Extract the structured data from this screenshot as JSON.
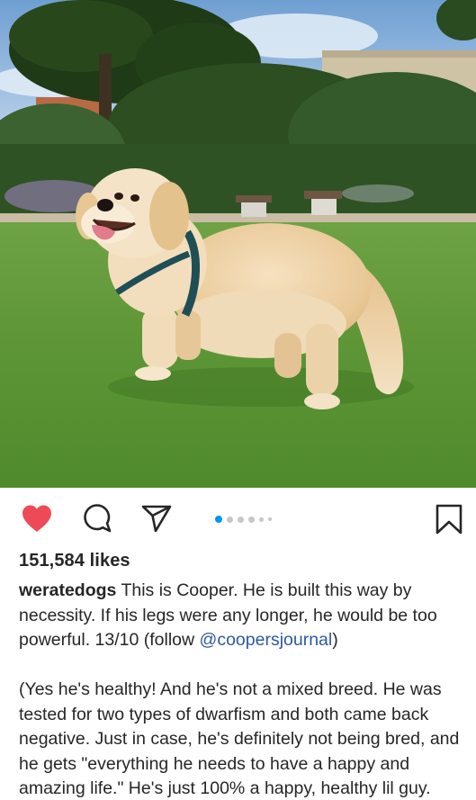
{
  "post": {
    "likes_text": "151,584 likes",
    "username": "weratedogs",
    "caption_part1": " This is Cooper. He is built this way by necessity. If his legs were any longer, he would be too powerful. 13/10 (follow ",
    "mention": "@coopersjournal",
    "caption_part1_end": ")",
    "caption_part2": "(Yes he's healthy! And he's not a mixed breed. He was tested for two types of dwarfism and both came back negative. Just in case, he's definitely not being bred, and he gets \"everything he needs to have a happy and amazing life.\" He's just 100% a happy, healthy lil guy."
  },
  "carousel": {
    "total_dots": 6,
    "active_index": 0
  },
  "actions": {
    "like_state": "liked",
    "icons": [
      "heart-icon",
      "comment-icon",
      "share-icon",
      "bookmark-icon"
    ]
  },
  "colors": {
    "like_red": "#ed4956",
    "carousel_active": "#0095f6",
    "mention_blue": "#2b5aa0",
    "text": "#262626"
  }
}
